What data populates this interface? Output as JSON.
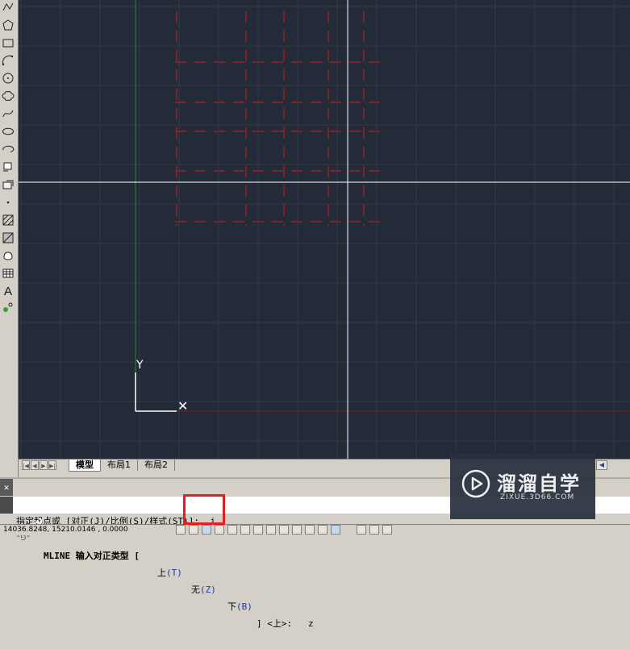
{
  "canvas": {
    "background": "#242b38",
    "grid_color": "#303848",
    "drawing_color": "#b02020",
    "ucs": {
      "y_label": "Y",
      "x_mark": "✕"
    }
  },
  "toolbar": {
    "tools": [
      "polyline-icon",
      "polygon-icon",
      "rectangle-icon",
      "arc-icon",
      "circle-icon",
      "revcloud-icon",
      "spline-icon",
      "ellipse-icon",
      "ellipse-arc-icon",
      "insert-block-icon",
      "make-block-icon",
      "point-icon",
      "hatch-icon",
      "gradient-icon",
      "region-icon",
      "table-icon",
      "mtext-icon",
      "add-selected-icon"
    ],
    "text_tool_label": "A"
  },
  "tabs": {
    "model": "模型",
    "layout1": "布局1",
    "layout2": "布局2"
  },
  "command": {
    "close_glyph": "✕",
    "line1": "指定起点或 [对正(J)/比例(S)/样式(ST)]:  j",
    "line2_prefix": "MLINE 输入对正类型 [",
    "opt_top_label": "上",
    "opt_top_key": "(T)",
    "opt_zero_label": "无",
    "opt_zero_key": "(Z)",
    "opt_bottom_label": "下",
    "opt_bottom_key": "(B)",
    "line2_suffix": "] <上>:   z",
    "icon_text": "°⅁°"
  },
  "status": {
    "coordinates": "14036.8248, 15210.0146 , 0.0000"
  },
  "watermark": {
    "title": "溜溜自学",
    "url": "ZIXUE.3D66.COM"
  }
}
